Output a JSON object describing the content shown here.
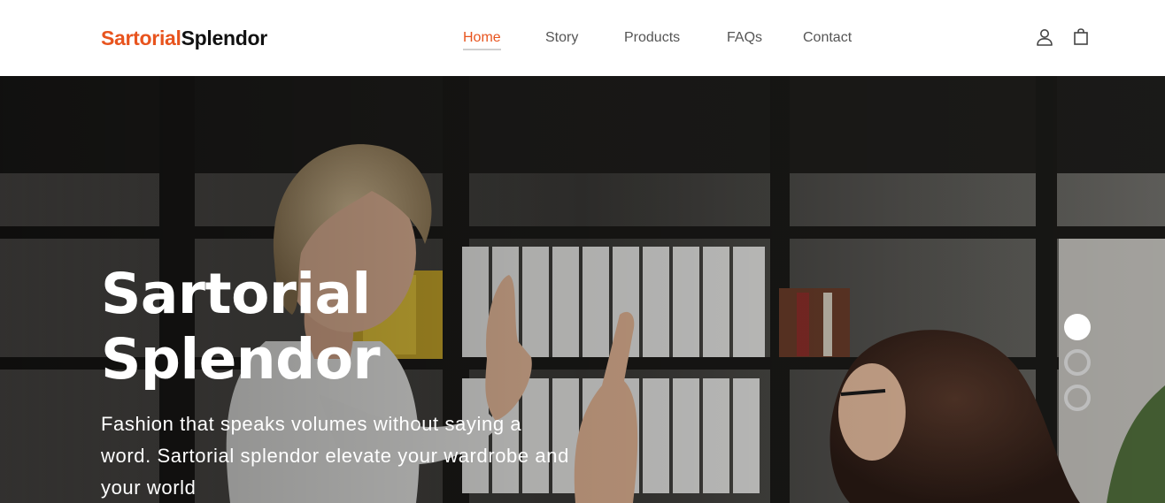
{
  "brand": {
    "accent": "Sartorial",
    "rest": "Splendor"
  },
  "nav": {
    "items": [
      {
        "label": "Home",
        "active": true
      },
      {
        "label": "Story",
        "active": false
      },
      {
        "label": "Products",
        "active": false
      },
      {
        "label": "FAQs",
        "active": false
      },
      {
        "label": "Contact",
        "active": false
      }
    ],
    "icons": [
      "user-icon",
      "shopping-bag-icon"
    ]
  },
  "hero": {
    "title_line1": "Sartorial",
    "title_line2": "Splendor",
    "subtitle": "Fashion that speaks volumes without saying a word. Sartorial splendor elevate your wardrobe and your world",
    "slides": {
      "count": 3,
      "active_index": 0
    }
  },
  "colors": {
    "accent": "#e8541e",
    "nav_text": "#555555",
    "hero_text": "#ffffff"
  }
}
